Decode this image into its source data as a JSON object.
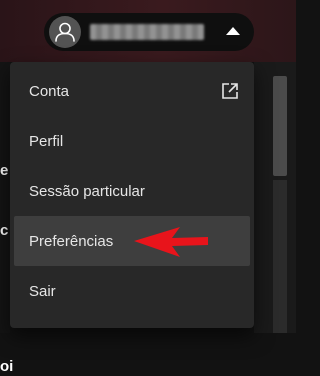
{
  "header": {
    "avatar_icon": "user-icon",
    "caret_icon": "caret-up-icon"
  },
  "menu": {
    "items": [
      {
        "label": "Conta",
        "icon": "external-link-icon"
      },
      {
        "label": "Perfil"
      },
      {
        "label": "Sessão particular"
      },
      {
        "label": "Preferências",
        "highlighted": true
      },
      {
        "label": "Sair"
      }
    ]
  },
  "annotation": {
    "arrow_color": "#e8141b",
    "arrow_points_to": "Preferências"
  },
  "colors": {
    "menu_background": "#282828",
    "menu_item_highlight": "#3e3e3e",
    "text": "#e6e6e6"
  }
}
